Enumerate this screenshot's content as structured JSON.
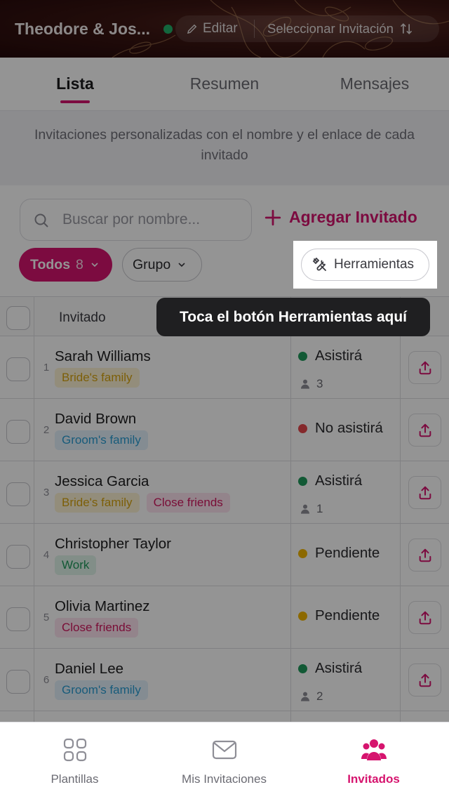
{
  "header": {
    "event_title": "Theodore & Jos...",
    "edit_label": "Editar",
    "select_label": "Seleccionar Invitación"
  },
  "tabs": [
    {
      "label": "Lista",
      "active": true
    },
    {
      "label": "Resumen",
      "active": false
    },
    {
      "label": "Mensajes",
      "active": false
    }
  ],
  "banner": {
    "text": "Invitaciones personalizadas con el nombre y el enlace de cada invitado"
  },
  "search": {
    "placeholder": "Buscar por nombre..."
  },
  "add_guest_label": "Agregar Invitado",
  "filters": {
    "all_label": "Todos",
    "all_count": "8",
    "group_label": "Grupo",
    "tools_label": "Herramientas"
  },
  "tooltip": {
    "text": "Toca el botón Herramientas aquí"
  },
  "table": {
    "header_name": "Invitado",
    "rows": [
      {
        "num": "1",
        "name": "Sarah Williams",
        "tags": [
          {
            "label": "Bride's family",
            "kind": "brides"
          }
        ],
        "status": "Asistirá",
        "status_color": "#1f9a5c",
        "party": "3"
      },
      {
        "num": "2",
        "name": "David Brown",
        "tags": [
          {
            "label": "Groom's family",
            "kind": "grooms"
          }
        ],
        "status": "No asistirá",
        "status_color": "#e5484d",
        "party": ""
      },
      {
        "num": "3",
        "name": "Jessica Garcia",
        "tags": [
          {
            "label": "Bride's family",
            "kind": "brides"
          },
          {
            "label": "Close friends",
            "kind": "friends"
          }
        ],
        "status": "Asistirá",
        "status_color": "#1f9a5c",
        "party": "1"
      },
      {
        "num": "4",
        "name": "Christopher Taylor",
        "tags": [
          {
            "label": "Work",
            "kind": "work"
          }
        ],
        "status": "Pendiente",
        "status_color": "#f2b600",
        "party": ""
      },
      {
        "num": "5",
        "name": "Olivia Martinez",
        "tags": [
          {
            "label": "Close friends",
            "kind": "friends"
          }
        ],
        "status": "Pendiente",
        "status_color": "#f2b600",
        "party": ""
      },
      {
        "num": "6",
        "name": "Daniel Lee",
        "tags": [
          {
            "label": "Groom's family",
            "kind": "grooms"
          }
        ],
        "status": "Asistirá",
        "status_color": "#1f9a5c",
        "party": "2"
      }
    ]
  },
  "bottom_nav": [
    {
      "label": "Plantillas",
      "icon": "grid-icon",
      "active": false
    },
    {
      "label": "Mis Invitaciones",
      "icon": "envelope-icon",
      "active": false
    },
    {
      "label": "Invitados",
      "icon": "people-icon",
      "active": true
    }
  ],
  "colors": {
    "accent": "#d6146e",
    "attending": "#1f9a5c",
    "declined": "#e5484d",
    "pending": "#f2b600"
  }
}
